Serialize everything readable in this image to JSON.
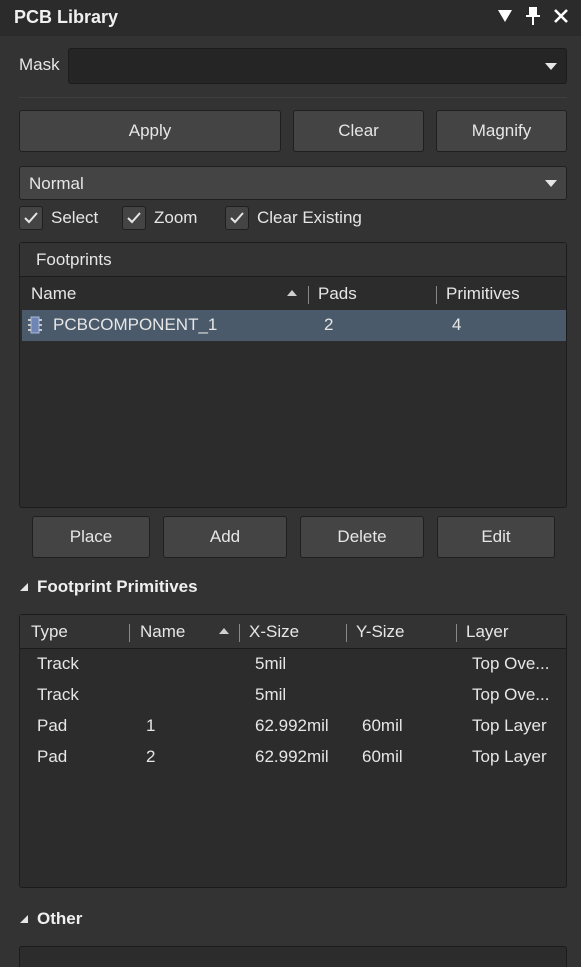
{
  "window": {
    "title": "PCB Library"
  },
  "mask": {
    "label": "Mask",
    "value": ""
  },
  "buttons": {
    "apply": "Apply",
    "clear": "Clear",
    "magnify": "Magnify"
  },
  "mode_select": {
    "value": "Normal"
  },
  "checkboxes": [
    {
      "label": "Select",
      "checked": true
    },
    {
      "label": "Zoom",
      "checked": true
    },
    {
      "label": "Clear Existing",
      "checked": true
    }
  ],
  "footprints": {
    "title": "Footprints",
    "columns": [
      "Name",
      "Pads",
      "Primitives"
    ],
    "rows": [
      {
        "name": "PCBCOMPONENT_1",
        "pads": "2",
        "primitives": "4"
      }
    ]
  },
  "footprint_buttons": {
    "place": "Place",
    "add": "Add",
    "delete": "Delete",
    "edit": "Edit"
  },
  "primitives": {
    "section_label": "Footprint Primitives",
    "columns": [
      "Type",
      "Name",
      "X-Size",
      "Y-Size",
      "Layer"
    ],
    "rows": [
      {
        "type": "Track",
        "name": "",
        "xsize": "5mil",
        "ysize": "",
        "layer": "Top Ove..."
      },
      {
        "type": "Track",
        "name": "",
        "xsize": "5mil",
        "ysize": "",
        "layer": "Top Ove..."
      },
      {
        "type": "Pad",
        "name": "1",
        "xsize": "62.992mil",
        "ysize": "60mil",
        "layer": "Top Layer"
      },
      {
        "type": "Pad",
        "name": "2",
        "xsize": "62.992mil",
        "ysize": "60mil",
        "layer": "Top Layer"
      }
    ]
  },
  "other": {
    "section_label": "Other"
  },
  "colors": {
    "panel": "#333333",
    "selection": "#4a5a6b",
    "button": "#444444",
    "text": "#e6e6e6"
  }
}
